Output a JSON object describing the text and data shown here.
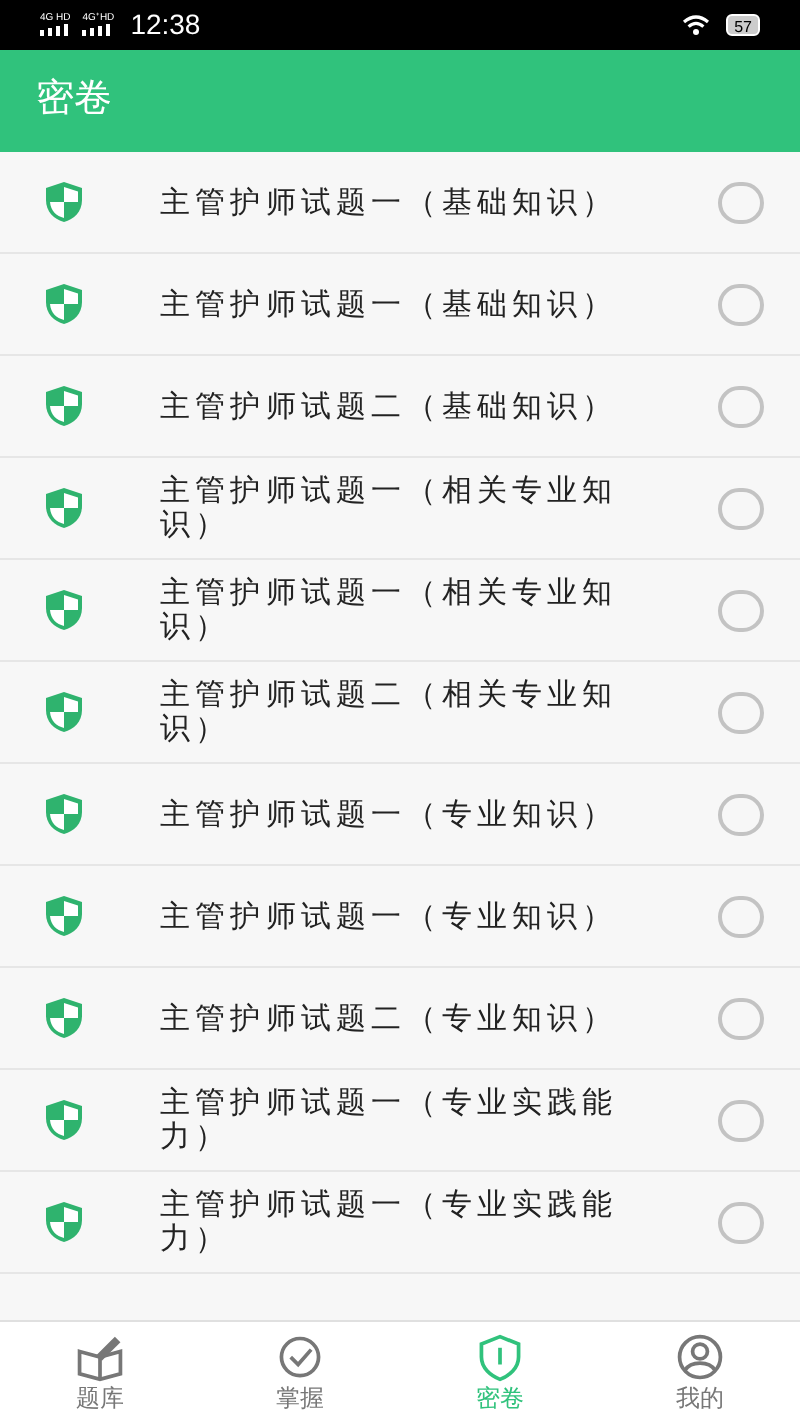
{
  "status_bar": {
    "signal_1": "4G HD",
    "signal_2": "4G⁺HD",
    "time": "12:38",
    "battery": "57"
  },
  "header": {
    "title": "密卷"
  },
  "items": [
    {
      "title": "主管护师试题一（基础知识）",
      "selected": false
    },
    {
      "title": "主管护师试题一（基础知识）",
      "selected": false
    },
    {
      "title": "主管护师试题二（基础知识）",
      "selected": false
    },
    {
      "title": "主管护师试题一（相关专业知识）",
      "selected": false
    },
    {
      "title": "主管护师试题一（相关专业知识）",
      "selected": false
    },
    {
      "title": "主管护师试题二（相关专业知识）",
      "selected": false
    },
    {
      "title": "主管护师试题一（专业知识）",
      "selected": false
    },
    {
      "title": "主管护师试题一（专业知识）",
      "selected": false
    },
    {
      "title": "主管护师试题二（专业知识）",
      "selected": false
    },
    {
      "title": "主管护师试题一（专业实践能力）",
      "selected": false
    },
    {
      "title": "主管护师试题一（专业实践能力）",
      "selected": false
    }
  ],
  "bottom_nav": [
    {
      "label": "题库",
      "kind": "book",
      "selected": false
    },
    {
      "label": "掌握",
      "kind": "check",
      "selected": false
    },
    {
      "label": "密卷",
      "kind": "shield",
      "selected": true
    },
    {
      "label": "我的",
      "kind": "person",
      "selected": false
    }
  ]
}
